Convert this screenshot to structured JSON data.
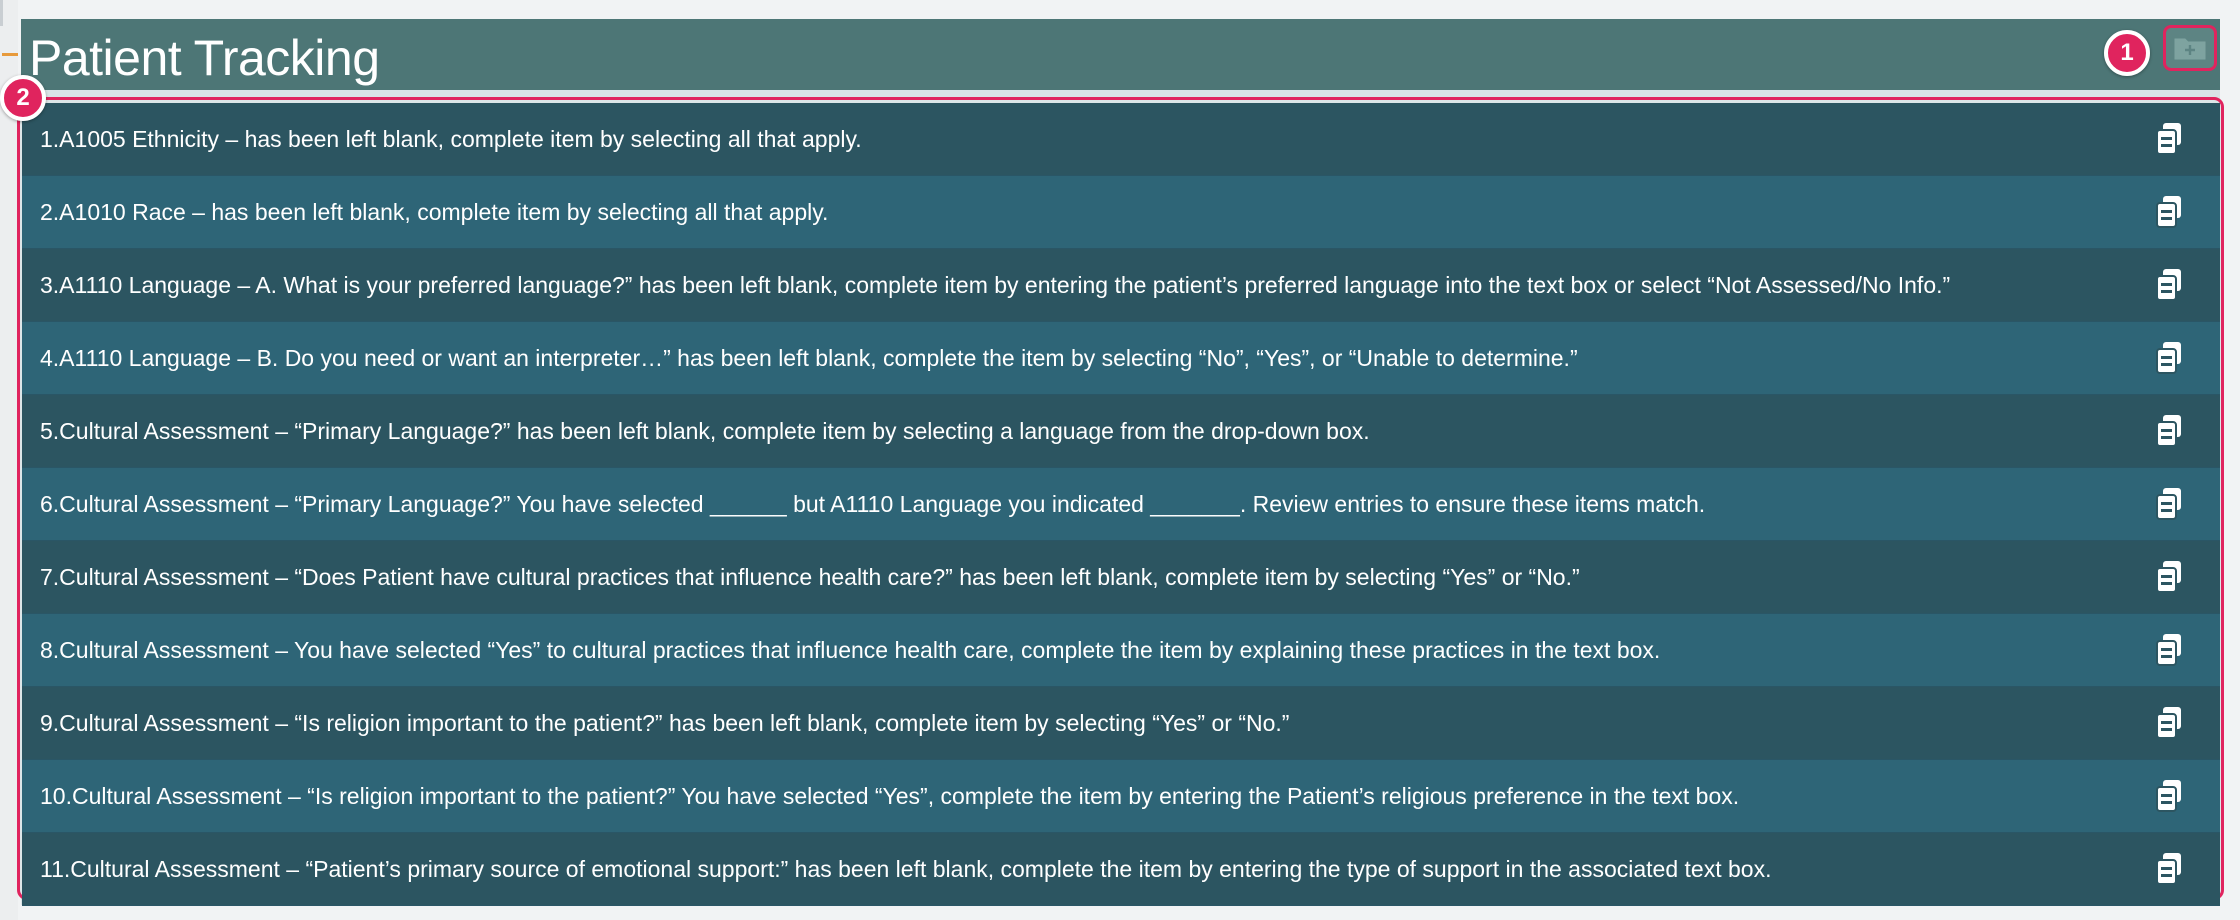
{
  "header": {
    "title": "Patient Tracking"
  },
  "badges": {
    "first": "1",
    "second": "2"
  },
  "items": [
    {
      "text": "1.A1005 Ethnicity – has been left blank, complete item by selecting all that apply."
    },
    {
      "text": "2.A1010 Race – has been left blank, complete item by selecting all that apply."
    },
    {
      "text": "3.A1110 Language – A. What is your preferred language?” has been left blank, complete item by entering the patient’s preferred language into the text box or select “Not Assessed/No Info.”"
    },
    {
      "text": "4.A1110 Language – B. Do you need or want an interpreter…” has been left blank, complete the item by selecting “No”, “Yes”, or “Unable to determine.”"
    },
    {
      "text": "5.Cultural Assessment – “Primary Language?” has been left blank, complete item by selecting a language from the drop-down box."
    },
    {
      "text": "6.Cultural Assessment – “Primary Language?” You have selected ______ but A1110 Language you indicated _______. Review entries to ensure these items match."
    },
    {
      "text": "7.Cultural Assessment – “Does Patient have cultural practices that influence health care?” has been left blank, complete item by selecting “Yes” or “No.”"
    },
    {
      "text": "8.Cultural Assessment – You have selected “Yes” to cultural practices that influence health care, complete the item by explaining these practices in the text box."
    },
    {
      "text": "9.Cultural Assessment – “Is religion important to the patient?” has been left blank, complete item by selecting “Yes” or “No.”"
    },
    {
      "text": "10.Cultural Assessment – “Is religion important to the patient?” You have selected “Yes”, complete the item by entering the Patient’s religious preference in the text box."
    },
    {
      "text": "11.Cultural Assessment – “Patient’s primary source of emotional support:” has been left blank, complete the item by entering the type of support in the associated text box."
    }
  ],
  "icons": {
    "row_action": "copy-icon",
    "header_action": "folder-plus-icon"
  },
  "colors": {
    "header_bg": "#4d7676",
    "row_dark": "#2c5561",
    "row_light": "#2e6577",
    "highlight": "#e0245e"
  }
}
